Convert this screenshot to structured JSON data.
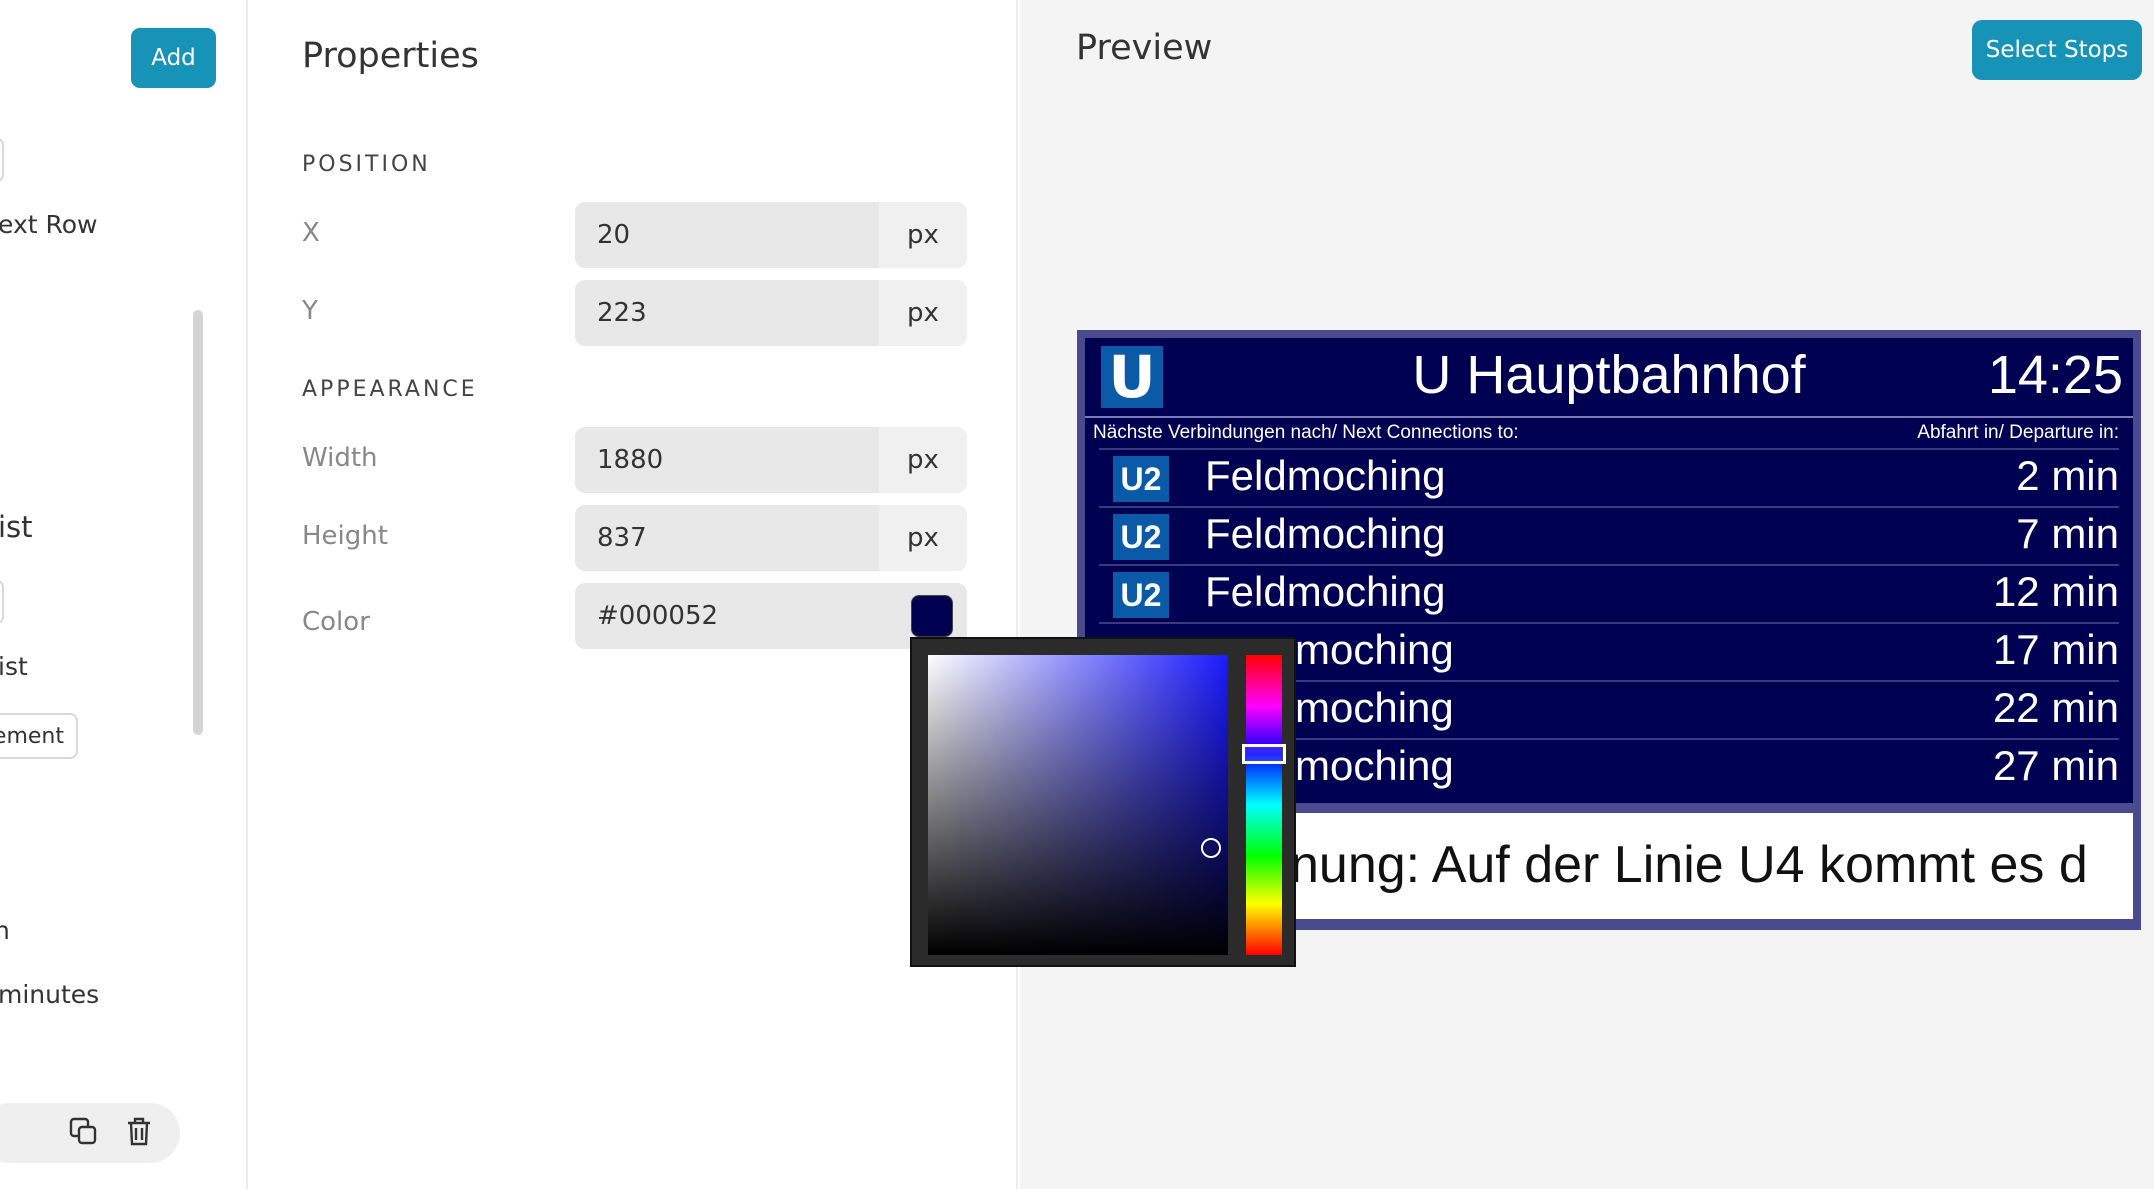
{
  "sidebar": {
    "add_label": "Add",
    "text_row_label": "ext Row",
    "list_label_1": "ist",
    "list_label_2": "ist",
    "element_button_label": "ement",
    "label_n": "n",
    "minutes_label": "minutes",
    "icons": [
      "copy-icon",
      "trash-icon"
    ]
  },
  "properties": {
    "title": "Properties",
    "position_section": "POSITION",
    "appearance_section": "APPEARANCE",
    "x": {
      "label": "X",
      "value": "20",
      "unit": "px"
    },
    "y": {
      "label": "Y",
      "value": "223",
      "unit": "px"
    },
    "width": {
      "label": "Width",
      "value": "1880",
      "unit": "px"
    },
    "height": {
      "label": "Height",
      "value": "837",
      "unit": "px"
    },
    "color": {
      "label": "Color",
      "value": "#000052"
    }
  },
  "preview": {
    "title": "Preview",
    "select_stops_label": "Select Stops",
    "board": {
      "logo": "U",
      "station": "U Hauptbahnhof",
      "time": "14:25",
      "subheader_left": "Nächste Verbindungen nach/ Next Connections to:",
      "subheader_right": "Abfahrt in/ Departure in:",
      "departures": [
        {
          "line": "U2",
          "destination": "Feldmoching",
          "time": "2 min"
        },
        {
          "line": "U2",
          "destination": "Feldmoching",
          "time": "7 min"
        },
        {
          "line": "U2",
          "destination": "Feldmoching",
          "time": "12 min"
        },
        {
          "line": "",
          "destination": "moching",
          "time": "17 min"
        },
        {
          "line": "",
          "destination": "moching",
          "time": "22 min"
        },
        {
          "line": "",
          "destination": "moching",
          "time": "27 min"
        }
      ],
      "ticker": "nung: Auf der Linie U4 kommt es d",
      "colors": {
        "background": "#000052",
        "line_badge": "#0a5aa8",
        "frame": "#4a4a8e"
      }
    }
  },
  "color_picker": {
    "current_color": "#000052"
  }
}
